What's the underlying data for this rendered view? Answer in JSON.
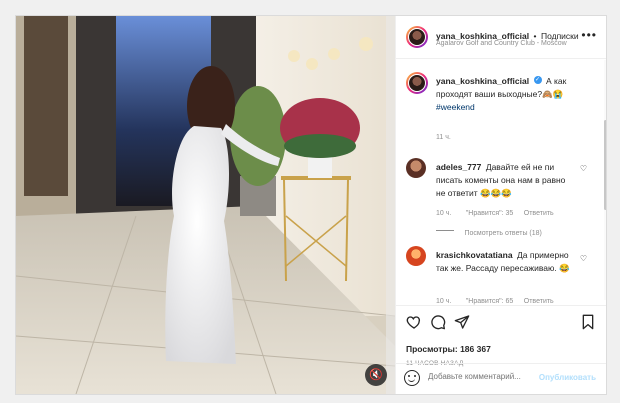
{
  "header": {
    "username": "yana_koshkina_official",
    "separator": "•",
    "follow_label": "Подписки",
    "location": "Agalarov Golf and Country Club - Moscow",
    "more_icon": "more-horizontal-icon"
  },
  "caption": {
    "username": "yana_koshkina_official",
    "text": "А как проходят ваши выходные?🙈😭",
    "hashtag": "#weekend",
    "time": "11 ч."
  },
  "comments": [
    {
      "username": "adeles_777",
      "text": "Давайте ей не пи писать коменты она нам в равно не ответит 😂😂😂",
      "time": "10 ч.",
      "likes": "\"Нравится\": 35",
      "reply_label": "Ответить",
      "view_replies": "Посмотреть ответы (18)"
    },
    {
      "username": "krasichkovatatiana",
      "text": "Да примерно так же. Рассаду пересаживаю. 😂",
      "time": "10 ч.",
      "likes": "\"Нравится\": 65",
      "reply_label": "Ответить"
    }
  ],
  "stats": {
    "views": "Просмотры: 186 367",
    "time_ago": "11 ЧАСОВ НАЗАД"
  },
  "add_comment": {
    "emoji_icon": "smiley-icon",
    "placeholder": "Добавьте комментарий...",
    "publish_label": "Опубликовать"
  },
  "video": {
    "mute_icon": "speaker-muted-icon"
  },
  "colors": {
    "link": "#0095f6",
    "hashtag": "#00376b",
    "text": "#262626",
    "muted": "#8e8e8e"
  }
}
